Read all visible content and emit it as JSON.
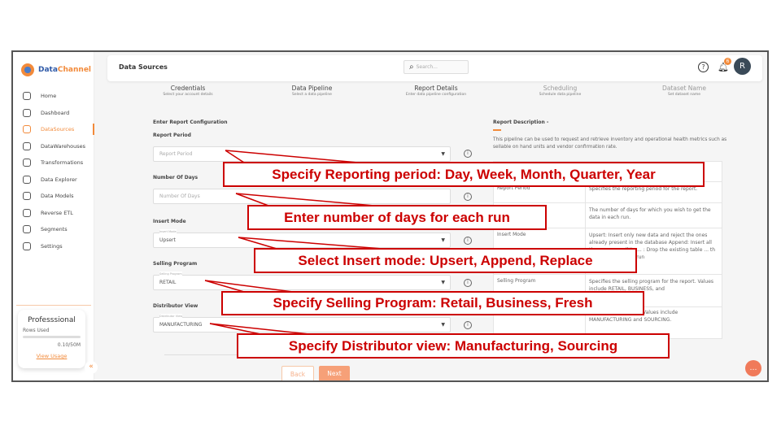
{
  "brand": {
    "name_part1": "Data",
    "name_part2": "Channel"
  },
  "sidebar": {
    "items": [
      {
        "label": "Home",
        "icon": "home-icon"
      },
      {
        "label": "Dashboard",
        "icon": "dashboard-icon"
      },
      {
        "label": "DataSources",
        "icon": "datasources-icon",
        "active": true
      },
      {
        "label": "DataWarehouses",
        "icon": "database-icon"
      },
      {
        "label": "Transformations",
        "icon": "transform-icon"
      },
      {
        "label": "Data Explorer",
        "icon": "explorer-icon"
      },
      {
        "label": "Data Models",
        "icon": "models-icon"
      },
      {
        "label": "Reverse ETL",
        "icon": "reverse-etl-icon"
      },
      {
        "label": "Segments",
        "icon": "segments-icon"
      },
      {
        "label": "Settings",
        "icon": "gear-icon"
      }
    ],
    "plan": {
      "title": "Professsional",
      "rows_label": "Rows Used",
      "usage": "0.10/50M",
      "usage_fraction": 0.002,
      "link": "View Usage"
    },
    "collapse": "«"
  },
  "header": {
    "title": "Data Sources",
    "search_placeholder": "Search...",
    "notifications": "6",
    "avatar": "R"
  },
  "steps": [
    {
      "title": "Credentials",
      "sub": "Select your account details"
    },
    {
      "title": "Data Pipeline",
      "sub": "Select a data pipeline"
    },
    {
      "title": "Report Details",
      "sub": "Enter data pipeline configuration"
    },
    {
      "title": "Scheduling",
      "sub": "Schedule data pipeline"
    },
    {
      "title": "Dataset Name",
      "sub": "Set dataset name"
    }
  ],
  "form": {
    "heading": "Enter Report Configuration",
    "report_period": {
      "label": "Report Period",
      "placeholder": "Report Period"
    },
    "number_of_days": {
      "label": "Number Of Days",
      "placeholder": "Number Of Days"
    },
    "insert_mode": {
      "label": "Insert Mode",
      "floating": "Insert Mode",
      "value": "Upsert"
    },
    "selling_program": {
      "label": "Selling Program",
      "floating": "Selling Program",
      "value": "RETAIL"
    },
    "distributor_view": {
      "label": "Distributor View",
      "floating": "Distributor View",
      "value": "MANUFACTURING"
    },
    "back": "Back",
    "next": "Next"
  },
  "description": {
    "heading": "Report Description -",
    "text": "This pipeline can be used to request and retrieve inventory and operational health metrics such as sellable on hand units and vendor confirmation rate.",
    "rows": [
      {
        "name": "Report Period",
        "desc": "Specifies the reporting period for the report."
      },
      {
        "name": "",
        "desc": "The number of days for which you wish to get the data in each run."
      },
      {
        "name": "Insert Mode",
        "desc": "Upsert: Insert only new data and reject the ones already present in the database Append: Insert all the rows even if its ... : Drop the existing table ... th fresh data on each run"
      },
      {
        "name": "Selling Program",
        "desc": "Specifies the selling program for the report. Values include RETAIL, BUSINESS, and"
      },
      {
        "name": "",
        "desc": "...tor view requested. Values include MANUFACTURING and SOURCING."
      }
    ]
  },
  "callouts": [
    "Specify Reporting period: Day, Week, Month, Quarter, Year",
    "Enter number of days for each run",
    "Select Insert mode: Upsert, Append, Replace",
    "Specify Selling Program: Retail, Business, Fresh",
    "Specify Distributor view: Manufacturing, Sourcing"
  ],
  "colors": {
    "accent": "#f28a3a",
    "callout": "#cc0000",
    "avatar": "#3a4a58"
  }
}
